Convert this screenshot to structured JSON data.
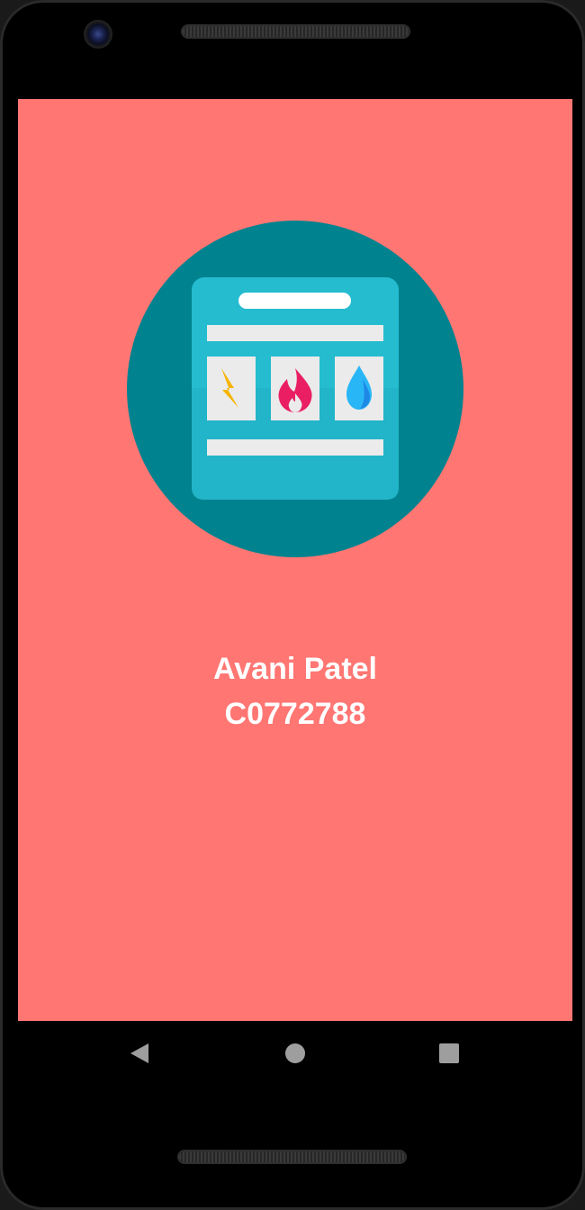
{
  "app": {
    "background_color": "#FF7673",
    "logo_icon": "utility-bill-icon",
    "logo_colors": {
      "circle": "#00838F",
      "card": "#25BCD0",
      "bars": "#EBEBEB",
      "electricity": "#F5B400",
      "gas": "#E91E63",
      "water": "#29B6F6"
    }
  },
  "profile": {
    "name": "Avani Patel",
    "student_id": "C0772788"
  },
  "navigation": {
    "back_icon": "back-triangle-icon",
    "home_icon": "home-circle-icon",
    "recents_icon": "recents-square-icon"
  }
}
